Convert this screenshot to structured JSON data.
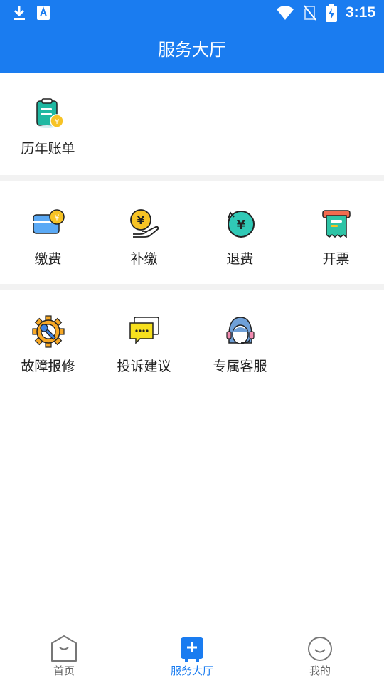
{
  "status_bar": {
    "time": "3:15",
    "icons": [
      "download-icon",
      "a-badge-icon",
      "wifi-icon",
      "no-sim-icon",
      "battery-charging-icon"
    ]
  },
  "header": {
    "title": "服务大厅"
  },
  "sections": [
    {
      "items": [
        {
          "label": "历年账单",
          "icon": "bill-history-icon"
        }
      ]
    },
    {
      "items": [
        {
          "label": "缴费",
          "icon": "card-pay-icon"
        },
        {
          "label": "补缴",
          "icon": "hand-coin-icon"
        },
        {
          "label": "退费",
          "icon": "refund-icon"
        },
        {
          "label": "开票",
          "icon": "invoice-icon"
        }
      ]
    },
    {
      "items": [
        {
          "label": "故障报修",
          "icon": "gear-wrench-icon"
        },
        {
          "label": "投诉建议",
          "icon": "chat-bubble-icon"
        },
        {
          "label": "专属客服",
          "icon": "headset-agent-icon"
        }
      ]
    }
  ],
  "tabbar": {
    "active": "服务大厅",
    "tabs": [
      {
        "label": "首页",
        "icon": "home-icon"
      },
      {
        "label": "服务大厅",
        "icon": "service-hall-icon"
      },
      {
        "label": "我的",
        "icon": "smile-icon"
      }
    ]
  },
  "colors": {
    "primary": "#1a7cf0",
    "divider": "#f2f2f2",
    "tab_inactive": "#666666"
  }
}
